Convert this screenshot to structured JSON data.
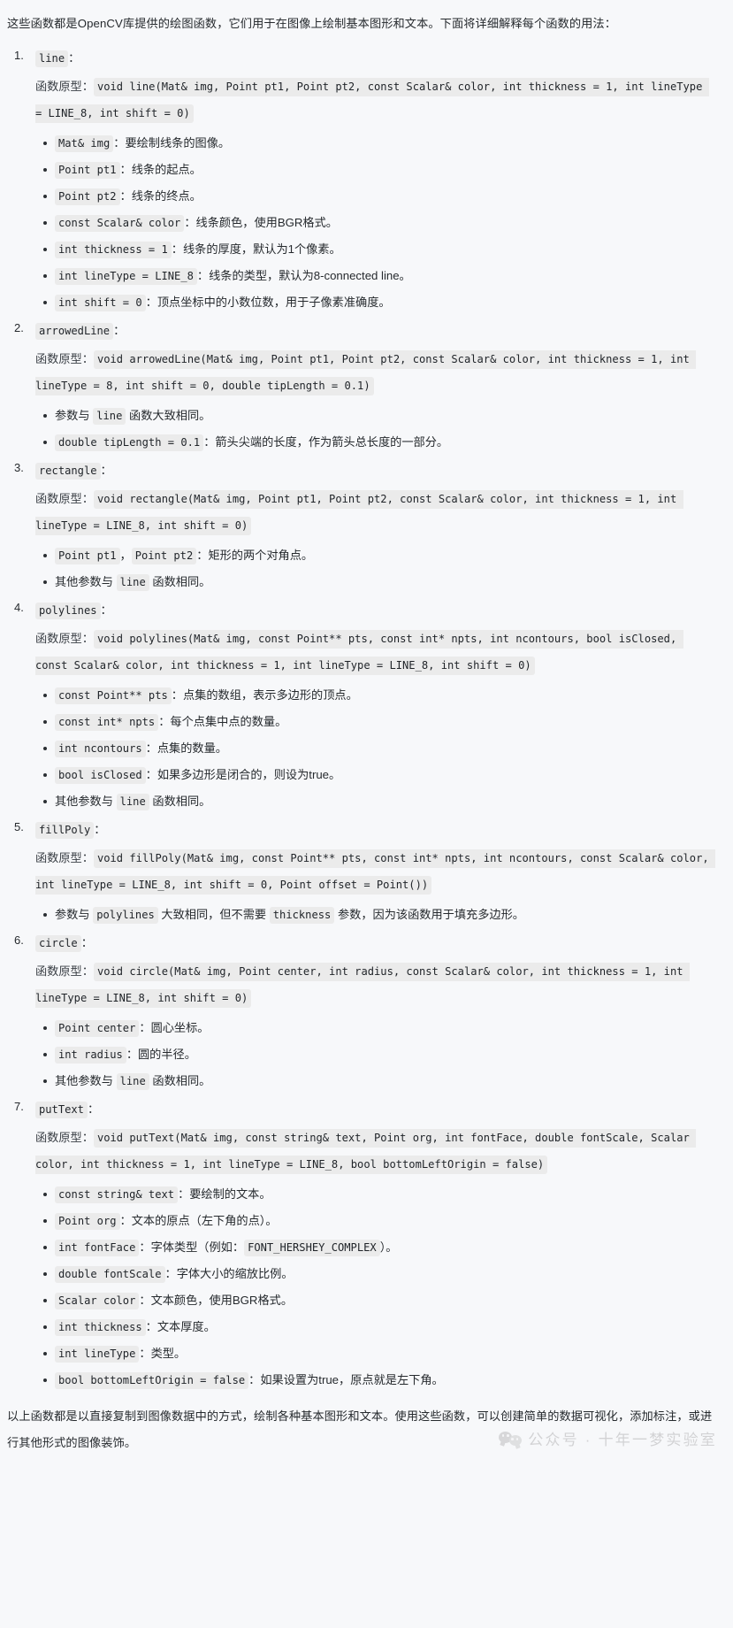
{
  "intro": "这些函数都是OpenCV库提供的绘图函数，它们用于在图像上绘制基本图形和文本。下面将详细解释每个函数的用法：",
  "proto_label": "函数原型：",
  "functions": [
    {
      "name": "line",
      "colon": "：",
      "prototype": "void line(Mat& img, Point pt1, Point pt2, const Scalar& color, int thickness = 1, int lineType = LINE_8, int shift = 0)",
      "params": [
        {
          "code": "Mat& img",
          "sep": "：",
          "desc": "要绘制线条的图像。"
        },
        {
          "code": "Point pt1",
          "sep": "：",
          "desc": "线条的起点。"
        },
        {
          "code": "Point pt2",
          "sep": "：",
          "desc": "线条的终点。"
        },
        {
          "code": "const Scalar& color",
          "sep": "：",
          "desc": "线条颜色，使用BGR格式。"
        },
        {
          "code": "int thickness = 1",
          "sep": "：",
          "desc": "线条的厚度，默认为1个像素。"
        },
        {
          "code": "int lineType = LINE_8",
          "sep": "：",
          "desc": "线条的类型，默认为8-connected line。"
        },
        {
          "code": "int shift = 0",
          "sep": "：",
          "desc": "顶点坐标中的小数位数，用于子像素准确度。"
        }
      ]
    },
    {
      "name": "arrowedLine",
      "colon": "：",
      "prototype": "void arrowedLine(Mat& img, Point pt1, Point pt2, const Scalar& color, int thickness = 1, int lineType = 8, int shift = 0, double tipLength = 0.1)",
      "params": [
        {
          "pre": "参数与 ",
          "code": "line",
          "sep": "",
          "desc": " 函数大致相同。"
        },
        {
          "code": "double tipLength = 0.1",
          "sep": "：",
          "desc": "箭头尖端的长度，作为箭头总长度的一部分。"
        }
      ]
    },
    {
      "name": "rectangle",
      "colon": "：",
      "prototype": "void rectangle(Mat& img, Point pt1, Point pt2, const Scalar& color, int thickness = 1, int lineType = LINE_8, int shift = 0)",
      "params": [
        {
          "code": "Point pt1",
          "code2": "Point pt2",
          "mid": "，",
          "sep": "：",
          "desc": "矩形的两个对角点。"
        },
        {
          "pre": "其他参数与 ",
          "code": "line",
          "sep": "",
          "desc": " 函数相同。"
        }
      ]
    },
    {
      "name": "polylines",
      "colon": "：",
      "prototype": "void polylines(Mat& img, const Point** pts, const int* npts, int ncontours, bool isClosed, const Scalar& color, int thickness = 1, int lineType = LINE_8, int shift = 0)",
      "params": [
        {
          "code": "const Point** pts",
          "sep": "：",
          "desc": "点集的数组，表示多边形的顶点。"
        },
        {
          "code": "const int* npts",
          "sep": "：",
          "desc": "每个点集中点的数量。"
        },
        {
          "code": "int ncontours",
          "sep": "：",
          "desc": "点集的数量。"
        },
        {
          "code": "bool isClosed",
          "sep": "：",
          "desc": "如果多边形是闭合的，则设为true。"
        },
        {
          "pre": "其他参数与 ",
          "code": "line",
          "sep": "",
          "desc": " 函数相同。"
        }
      ]
    },
    {
      "name": "fillPoly",
      "colon": "：",
      "prototype": "void fillPoly(Mat& img, const Point** pts, const int* npts, int ncontours, const Scalar& color, int lineType = LINE_8, int shift = 0, Point offset = Point())",
      "params": [
        {
          "pre": "参数与 ",
          "code": "polylines",
          "sep": "",
          "desc": " 大致相同，但不需要 ",
          "code3": "thickness",
          "desc2": " 参数，因为该函数用于填充多边形。"
        }
      ]
    },
    {
      "name": "circle",
      "colon": "：",
      "prototype": "void circle(Mat& img, Point center, int radius, const Scalar& color, int thickness = 1, int lineType = LINE_8, int shift = 0)",
      "params": [
        {
          "code": "Point center",
          "sep": "：",
          "desc": "圆心坐标。"
        },
        {
          "code": "int radius",
          "sep": "：",
          "desc": "圆的半径。"
        },
        {
          "pre": "其他参数与 ",
          "code": "line",
          "sep": "",
          "desc": " 函数相同。"
        }
      ]
    },
    {
      "name": "putText",
      "colon": "：",
      "prototype": "void putText(Mat& img, const string& text, Point org, int fontFace, double fontScale, Scalar color, int thickness = 1, int lineType = LINE_8, bool bottomLeftOrigin = false)",
      "params": [
        {
          "code": "const string& text",
          "sep": "：",
          "desc": "要绘制的文本。"
        },
        {
          "code": "Point org",
          "sep": "：",
          "desc": "文本的原点（左下角的点）。"
        },
        {
          "code": "int fontFace",
          "sep": "：",
          "desc": "字体类型（例如：",
          "code3": "FONT_HERSHEY_COMPLEX",
          "desc2": "）。"
        },
        {
          "code": "double fontScale",
          "sep": "：",
          "desc": "字体大小的缩放比例。"
        },
        {
          "code": "Scalar color",
          "sep": "：",
          "desc": "文本颜色，使用BGR格式。"
        },
        {
          "code": "int thickness",
          "sep": "：",
          "desc": "文本厚度。"
        },
        {
          "code": "int lineType",
          "sep": "：",
          "desc": "类型。"
        },
        {
          "code": "bool bottomLeftOrigin = false",
          "sep": "：",
          "desc": "如果设置为true，原点就是左下角。"
        }
      ]
    }
  ],
  "outro": "以上函数都是以直接复制到图像数据中的方式，绘制各种基本图形和文本。使用这些函数，可以创建简单的数据可视化，添加标注，或进行其他形式的图像装饰。",
  "watermark": {
    "icon": "wechat-icon",
    "text": "公众号 · 十年一梦实验室"
  },
  "colors": {
    "page_background": "#f7f8fa",
    "text": "#262a2e",
    "code_background": "#ebebeb",
    "watermark": "#8c8c8c"
  }
}
